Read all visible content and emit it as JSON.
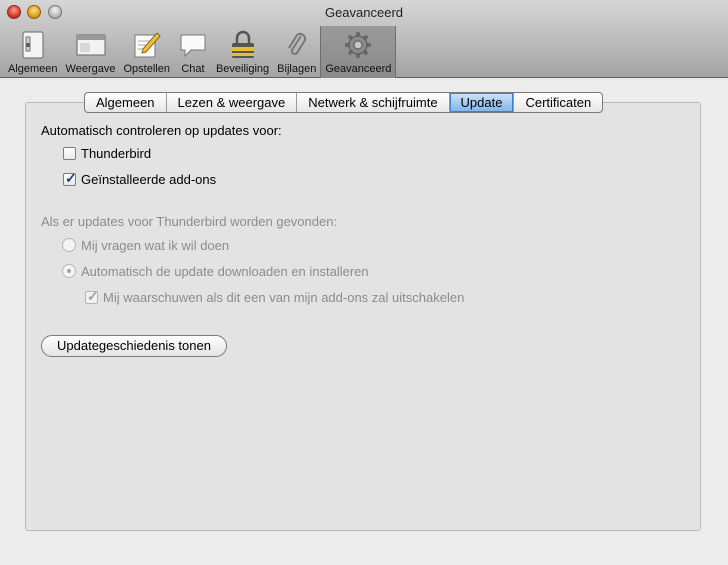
{
  "window": {
    "title": "Geavanceerd"
  },
  "toolbar": {
    "items": [
      {
        "label": "Algemeen",
        "icon": "general-switch-icon"
      },
      {
        "label": "Weergave",
        "icon": "display-window-icon"
      },
      {
        "label": "Opstellen",
        "icon": "compose-pencil-icon"
      },
      {
        "label": "Chat",
        "icon": "chat-bubble-icon"
      },
      {
        "label": "Beveiliging",
        "icon": "security-lock-icon"
      },
      {
        "label": "Bijlagen",
        "icon": "attachment-paperclip-icon"
      },
      {
        "label": "Geavanceerd",
        "icon": "advanced-gear-icon"
      }
    ],
    "selected": "Geavanceerd"
  },
  "tabs": {
    "items": [
      "Algemeen",
      "Lezen & weergave",
      "Netwerk & schijfruimte",
      "Update",
      "Certificaten"
    ],
    "active": "Update"
  },
  "update": {
    "auto_check_heading": "Automatisch controleren op updates voor:",
    "thunderbird_label": "Thunderbird",
    "thunderbird_checked": false,
    "addons_label": "Geïnstalleerde add-ons",
    "addons_checked": true,
    "when_found_heading": "Als er updates voor Thunderbird worden gevonden:",
    "ask_label": "Mij vragen wat ik wil doen",
    "auto_download_label": "Automatisch de update downloaden en installeren",
    "warn_label": "Mij waarschuwen als dit een van mijn add-ons zal uitschakelen",
    "warn_checked": true,
    "history_button": "Updategeschiedenis tonen"
  },
  "colors": {
    "active_tab": "#7fb3ea",
    "disabled_text": "#8c8c8c"
  }
}
